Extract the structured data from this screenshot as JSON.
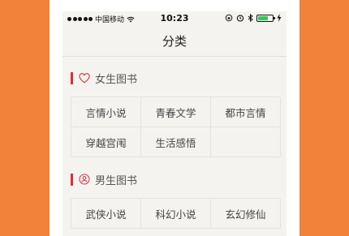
{
  "status_bar": {
    "carrier": "中国移动",
    "time": "10:23"
  },
  "nav": {
    "title": "分类"
  },
  "sections": [
    {
      "label": "女生图书",
      "icon": "heart-icon",
      "items": [
        "言情小说",
        "青春文学",
        "都市言情",
        "穿越宫闱",
        "生活感悟",
        ""
      ]
    },
    {
      "label": "男生图书",
      "icon": "person-icon",
      "items": [
        "武侠小说",
        "科幻小说",
        "玄幻修仙"
      ]
    }
  ],
  "colors": {
    "background": "#f2823a",
    "accent_bar": "#d9303a",
    "battery": "#34c759"
  }
}
